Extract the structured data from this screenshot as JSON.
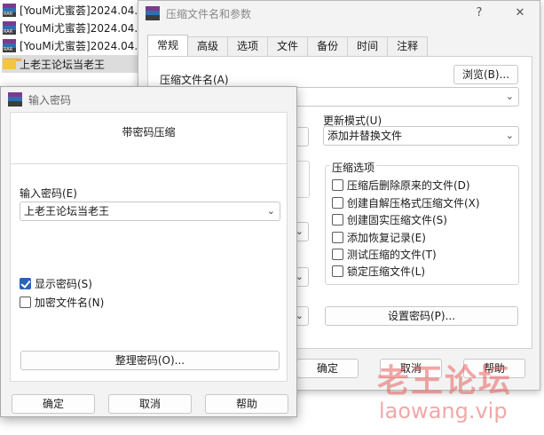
{
  "explorer": {
    "files": [
      {
        "name": "[YouMi尤蜜荟]2024.04.",
        "type": "rar"
      },
      {
        "name": "[YouMi尤蜜荟]2024.04.",
        "type": "rar"
      },
      {
        "name": "[YouMi尤蜜荟]2024.04.",
        "type": "rar"
      },
      {
        "name": "上老王论坛当老王",
        "type": "folder"
      }
    ]
  },
  "archive_dialog": {
    "title": "压缩文件名和参数",
    "help_button": "?",
    "close_button": "✕",
    "tabs": [
      "常规",
      "高级",
      "选项",
      "文件",
      "备份",
      "时间",
      "注释"
    ],
    "active_tab": "常规",
    "archive_name_label": "压缩文件名(A)",
    "browse_button": "浏览(B)...",
    "archive_name_value": "",
    "update_mode_label": "更新模式(U)",
    "update_mode_value": "添加并替换文件",
    "options_group_title": "压缩选项",
    "options": [
      {
        "label": "压缩后删除原来的文件(D)",
        "checked": false
      },
      {
        "label": "创建自解压格式压缩文件(X)",
        "checked": false
      },
      {
        "label": "创建固实压缩文件(S)",
        "checked": false
      },
      {
        "label": "添加恢复记录(E)",
        "checked": false
      },
      {
        "label": "测试压缩的文件(T)",
        "checked": false
      },
      {
        "label": "锁定压缩文件(L)",
        "checked": false
      }
    ],
    "set_password_button": "设置密码(P)...",
    "ok_button": "确定",
    "cancel_button": "取消",
    "help_btn": "帮助"
  },
  "password_dialog": {
    "title": "输入密码",
    "heading": "带密码压缩",
    "password_label": "输入密码(E)",
    "password_value": "上老王论坛当老王",
    "show_password_label": "显示密码(S)",
    "show_password_checked": true,
    "encrypt_names_label": "加密文件名(N)",
    "encrypt_names_checked": false,
    "organize_button": "整理密码(O)...",
    "ok_button": "确定",
    "cancel_button": "取消",
    "help_button": "帮助"
  },
  "watermark": {
    "text": "老王论坛",
    "url": "laowang.vip"
  }
}
